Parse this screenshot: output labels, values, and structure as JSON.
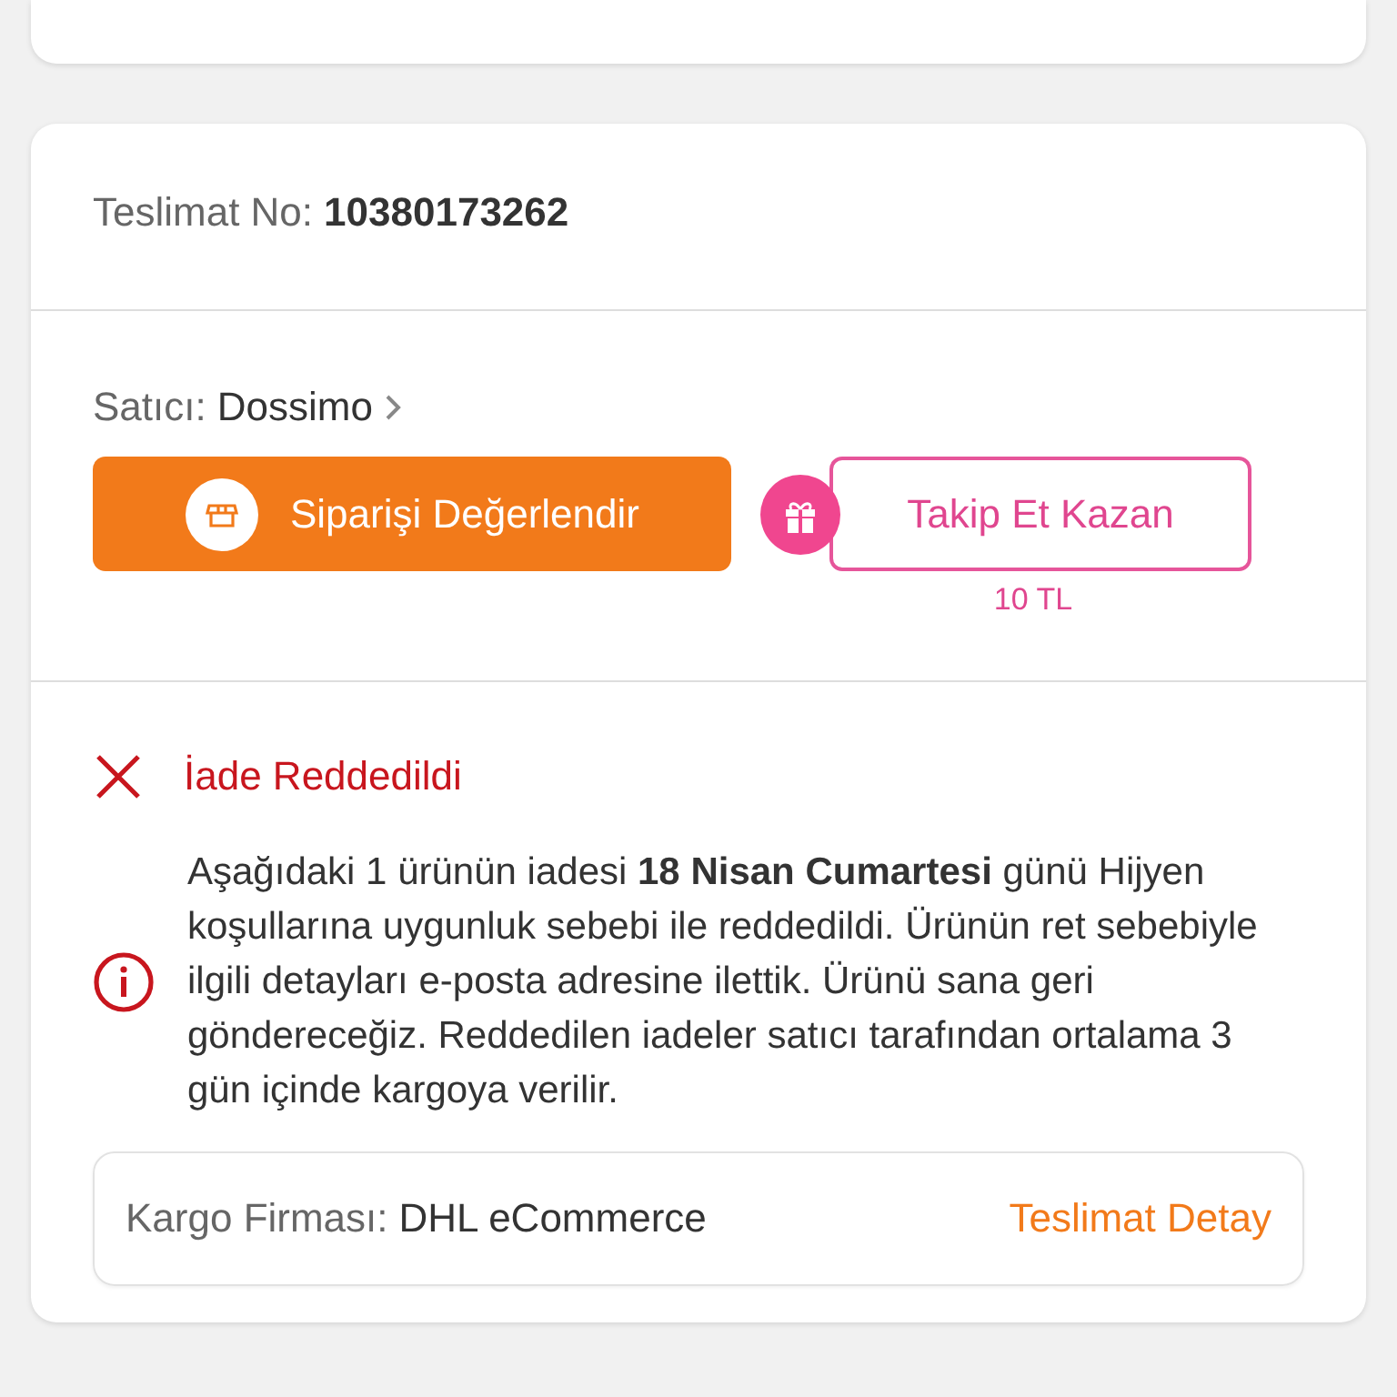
{
  "delivery": {
    "label": "Teslimat No:",
    "number": "10380173262"
  },
  "seller": {
    "label": "Satıcı:",
    "name": "Dossimo"
  },
  "actions": [
    {
      "kind": "primary",
      "label": "Siparişi Değerlendir"
    },
    {
      "kind": "reward",
      "label": "Takip Et Kazan",
      "note": "10 TL"
    }
  ],
  "return": {
    "status": "İade Reddedildi",
    "message": "Aşağıdaki 1 ürünün iadesi **18 Nisan Cumartesi** günü Hijyen koşullarına uygunluk sebebi ile reddedildi. Ürünün ret sebebiyle ilgili detayları e-posta adresine ilettik. Ürünü sana geri göndereceğiz. Reddedilen iadeler satıcı tarafından ortalama 3 gün içinde kargoya verilir."
  },
  "cargo": {
    "label": "Kargo Firması:",
    "company": "DHL eCommerce",
    "link": "Teslimat Detay"
  }
}
